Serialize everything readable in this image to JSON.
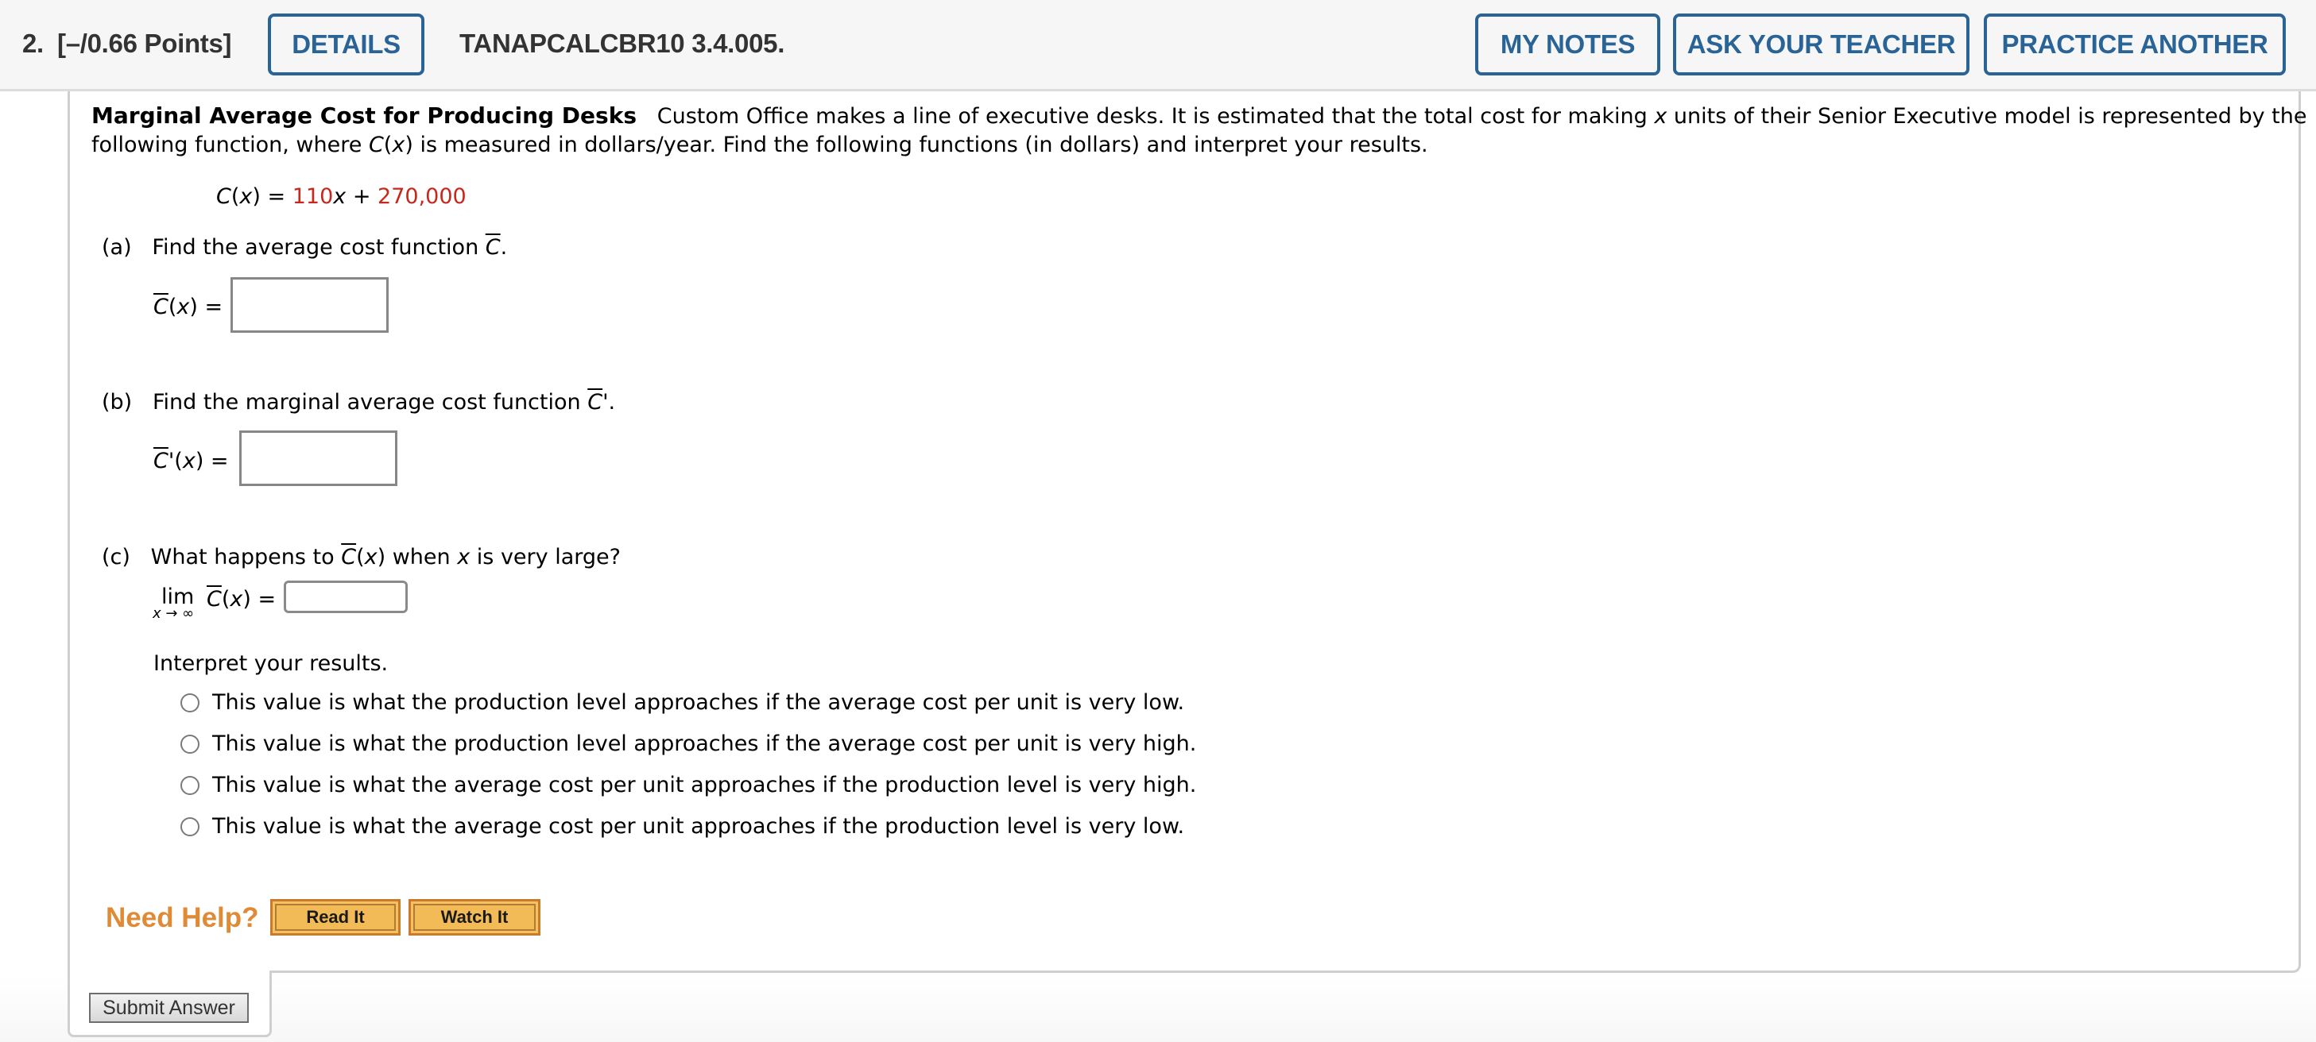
{
  "header": {
    "question_number": "2.",
    "points": "[–/0.66 Points]",
    "details_label": "DETAILS",
    "problem_id": "TANAPCALCBR10 3.4.005.",
    "my_notes_label": "MY NOTES",
    "ask_teacher_label": "ASK YOUR TEACHER",
    "practice_another_label": "PRACTICE ANOTHER"
  },
  "problem": {
    "title": "Marginal Average Cost for Producing Desks",
    "intro_line1_pre": "Custom Office makes a line of executive desks. It is estimated that the total cost for making ",
    "intro_var": "x",
    "intro_line1_post": " units of their Senior Executive model is represented by the",
    "intro_line2_pre": "following function, where ",
    "intro_line2_C": "C",
    "intro_line2_mid1": "(",
    "intro_line2_x": "x",
    "intro_line2_mid2": ") is measured in dollars/year. Find the following functions (in dollars) and interpret your results.",
    "equation": {
      "lhs_C": "C",
      "lhs_x": "x",
      "coef": "110",
      "var": "x",
      "plus": " + ",
      "constant": "270,000"
    }
  },
  "parts": {
    "a": {
      "label": "(a)",
      "prompt": "Find the average cost function ",
      "symbol": "C",
      "end": ".",
      "lhs": "C",
      "lhs_x": "x",
      "answer_value": ""
    },
    "b": {
      "label": "(b)",
      "prompt": "Find the marginal average cost function ",
      "symbol": "C",
      "end": "'.",
      "lhs": "C",
      "lhs_x": "x",
      "answer_value": ""
    },
    "c": {
      "label": "(c)",
      "prompt_pre": "What happens to ",
      "symbol": "C",
      "x": "x",
      "prompt_mid": " when ",
      "prompt_post": " is very large?",
      "lim": "lim",
      "lim_sub": "x → ∞",
      "answer_value": "",
      "interpret_label": "Interpret your results.",
      "options": [
        "This value is what the production level approaches if the average cost per unit is very low.",
        "This value is what the production level approaches if the average cost per unit is very high.",
        "This value is what the average cost per unit approaches if the production level is very high.",
        "This value is what the average cost per unit approaches if the production level is very low."
      ]
    }
  },
  "help": {
    "need_help_label": "Need Help?",
    "read_it_label": "Read It",
    "watch_it_label": "Watch It"
  },
  "submit_label": "Submit Answer",
  "colors": {
    "accent": "#2a6496",
    "equation_red": "#c8281c",
    "help_orange": "#e08a35",
    "help_button": "#f2bb57"
  }
}
